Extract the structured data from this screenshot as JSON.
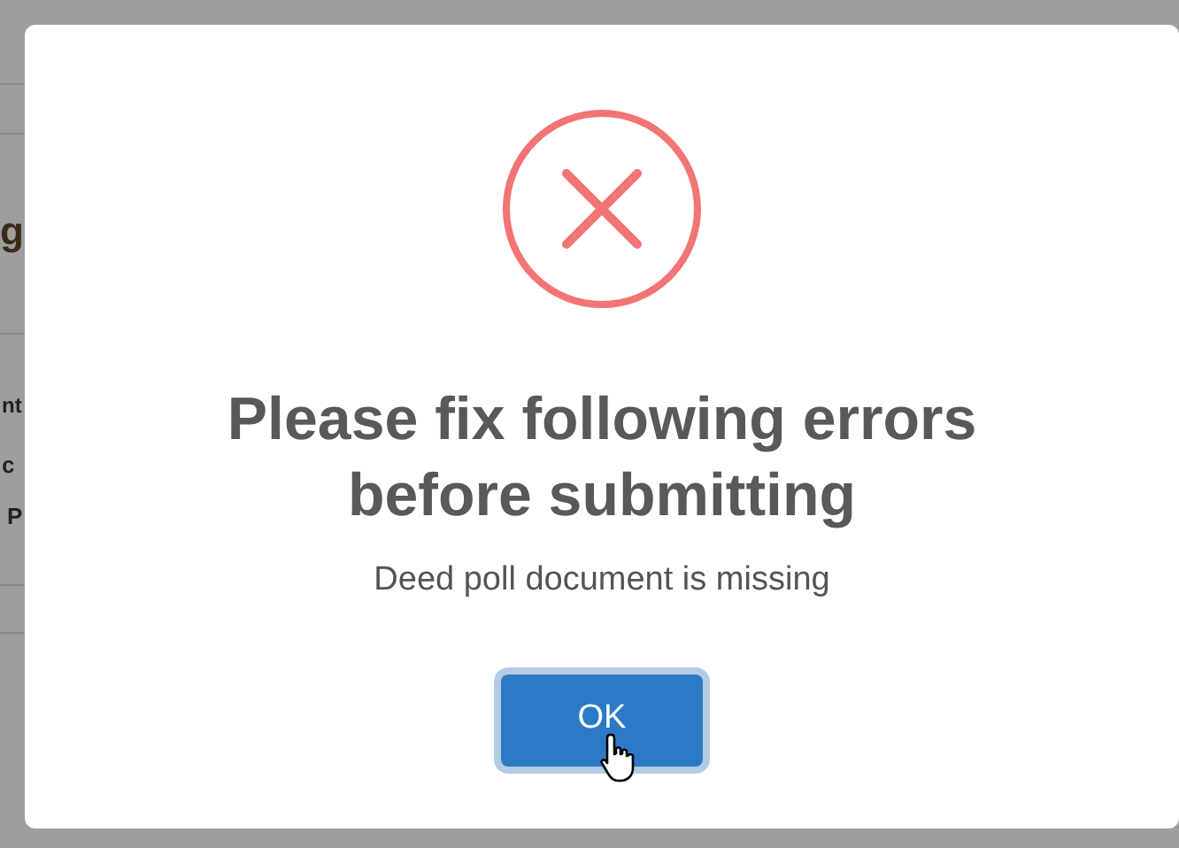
{
  "background": {
    "fragments": [
      "g",
      "nt",
      "c",
      "P"
    ]
  },
  "dialog": {
    "title": "Please fix following errors before submitting",
    "message": "Deed poll document is missing",
    "buttons": [
      {
        "label": "OK",
        "focused": true
      }
    ]
  }
}
